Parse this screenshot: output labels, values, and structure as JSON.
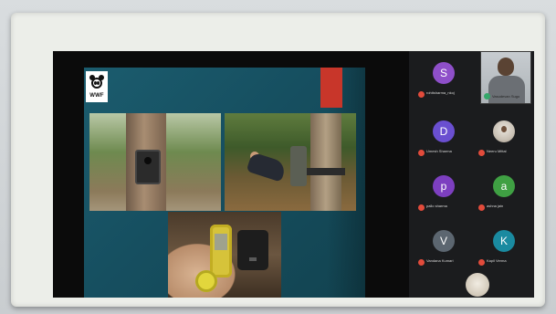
{
  "slide": {
    "logo_text": "WWF",
    "accent_color": "#c8362a",
    "background_color": "#1b5c6e"
  },
  "participants": [
    {
      "name": "rohitsharma_nkoj",
      "initial": "S",
      "color": "#8e4fc9",
      "mic": "muted"
    },
    {
      "name": "Vasudevan Sugo",
      "initial": "",
      "color": "",
      "mic": "on",
      "video": true
    },
    {
      "name": "Umesh Sharma",
      "initial": "D",
      "color": "#6a4fd0",
      "mic": "muted"
    },
    {
      "name": "Neeru Mittal",
      "initial": "",
      "color": "",
      "mic": "muted",
      "picture": true
    },
    {
      "name": "pallo sharma",
      "initial": "p",
      "color": "#7d3fc0",
      "mic": "muted"
    },
    {
      "name": "ashna jain",
      "initial": "a",
      "color": "#3fa043",
      "mic": "muted"
    },
    {
      "name": "Vandana Kumari",
      "initial": "V",
      "color": "#5c6670",
      "mic": "muted"
    },
    {
      "name": "Kapil Verma",
      "initial": "K",
      "color": "#1a8aa0",
      "mic": "muted"
    }
  ]
}
